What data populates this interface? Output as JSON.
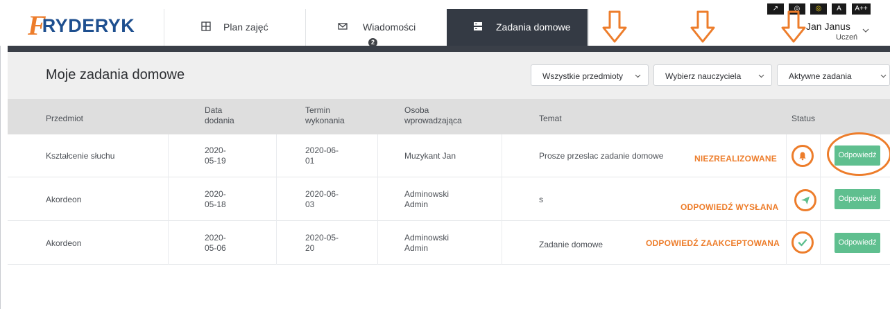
{
  "header": {
    "logo_letter": "F",
    "logo_text": "RYDERYK",
    "nav": {
      "plan_label": "Plan zajęć",
      "messages_label": "Wiadomości",
      "messages_badge": "2",
      "homework_label": "Zadania domowe"
    },
    "accessibility": [
      "↗",
      "◎",
      "◎",
      "A",
      "A++"
    ],
    "user": {
      "name": "Jan Janus",
      "role": "Uczeń"
    }
  },
  "page": {
    "title": "Moje zadania domowe",
    "filters": {
      "subject": "Wszystkie przedmioty",
      "teacher": "Wybierz nauczyciela",
      "status": "Aktywne zadania"
    }
  },
  "table": {
    "columns": {
      "subject": "Przedmiot",
      "added_l1": "Data",
      "added_l2": "dodania",
      "due_l1": "Termin",
      "due_l2": "wykonania",
      "person_l1": "Osoba",
      "person_l2": "wprowadzająca",
      "topic": "Temat",
      "status": "Status"
    },
    "rows": [
      {
        "subject": "Kształcenie słuchu",
        "added_l1": "2020-",
        "added_l2": "05-19",
        "due_l1": "2020-06-",
        "due_l2": "01",
        "person_l1": "Muzykant Jan",
        "person_l2": "",
        "topic": "Prosze przeslac zadanie domowe",
        "status_label": "NIEZREALIZOWANE",
        "status_icon": "bell-icon",
        "reply": "Odpowiedź"
      },
      {
        "subject": "Akordeon",
        "added_l1": "2020-",
        "added_l2": "05-18",
        "due_l1": "2020-06-",
        "due_l2": "03",
        "person_l1": "Adminowski",
        "person_l2": "Admin",
        "topic": "s",
        "status_label": "ODPOWIEDŹ WYSŁANA",
        "status_icon": "send-icon",
        "reply": "Odpowiedź"
      },
      {
        "subject": "Akordeon",
        "added_l1": "2020-",
        "added_l2": "05-06",
        "due_l1": "2020-05-",
        "due_l2": "20",
        "person_l1": "Adminowski",
        "person_l2": "Admin",
        "topic": "Zadanie domowe",
        "status_label": "ODPOWIEDŹ ZAAKCEPTOWANA",
        "status_icon": "check-icon",
        "reply": "Odpowiedź"
      }
    ]
  },
  "colors": {
    "accent_orange": "#ed7d2b",
    "brand_blue": "#1e4f8f",
    "nav_dark": "#343a44",
    "reply_green": "#5fbf8f"
  }
}
